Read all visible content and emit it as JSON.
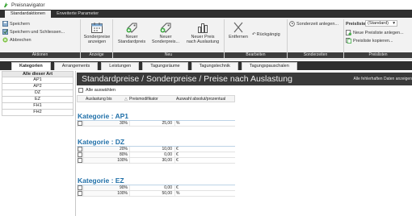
{
  "window": {
    "title": "Preisnavigator"
  },
  "ribbon_tabs": [
    "Standardaktionen",
    "Erweiterte Parameter"
  ],
  "ribbon": {
    "aktionen": {
      "label": "Aktionen",
      "save": "Speichern",
      "save_close": "Speichern und Schliessen...",
      "cancel": "Abbrechen"
    },
    "anzeige": {
      "label": "Anzeige",
      "btn_line1": "Sonderpreise",
      "btn_line2": "anzeigen"
    },
    "neu": {
      "label": "Neu",
      "btn1_line1": "Neuer",
      "btn1_line2": "Standardpreis",
      "btn2_line1": "Neuer",
      "btn2_line2": "Sonderpreis...",
      "btn3_line1": "Neuer Preis",
      "btn3_line2": "nach Auslastung"
    },
    "bearbeiten": {
      "label": "Bearbeiten",
      "remove": "Entfernen",
      "undo": "Rückgängig"
    },
    "sonderzeiten": {
      "label": "Sonderzeiten",
      "add": "Sonderzeit anlegen..."
    },
    "preislisten": {
      "label": "Preislisten",
      "list_label": "Preisliste",
      "list_value": "(Standard)",
      "new_list": "Neue Preisliste anlegen...",
      "copy_list": "Preisliste kopieren..."
    }
  },
  "content_tabs": [
    "Kategorien",
    "Arrangements",
    "Leistungen",
    "Tagungsräume",
    "Tagungstechnik",
    "Tagungspauschalen"
  ],
  "left_list": [
    "Alle dieser Art",
    "AP1",
    "AP2",
    "DZ",
    "EZ",
    "FH1",
    "FH2"
  ],
  "main": {
    "title": "Standardpreise / Sonderpreise / Preise nach Auslastung",
    "note": "Alle fehlerhaften Daten anzeigen",
    "select_all": "Alle auswählen",
    "columns": [
      "Auslastung bis",
      "Preismodifikator",
      "Auswahl absolut/prozentual"
    ],
    "sections": [
      {
        "title": "Kategorie : AP1",
        "rows": [
          [
            "30%",
            "25,00",
            "%"
          ]
        ]
      },
      {
        "title": "Kategorie : DZ",
        "rows": [
          [
            "20%",
            "10,00",
            "€"
          ],
          [
            "80%",
            "0,00",
            "€"
          ],
          [
            "100%",
            "30,00",
            "€"
          ]
        ]
      },
      {
        "title": "Kategorie : EZ",
        "rows": [
          [
            "90%",
            "0,00",
            "€"
          ],
          [
            "100%",
            "50,00",
            "%"
          ]
        ]
      }
    ]
  },
  "colors": {
    "accent": "#1f6fa8",
    "ribbon_dark": "#2f2f2f",
    "header_dark": "#3a3a3a"
  }
}
